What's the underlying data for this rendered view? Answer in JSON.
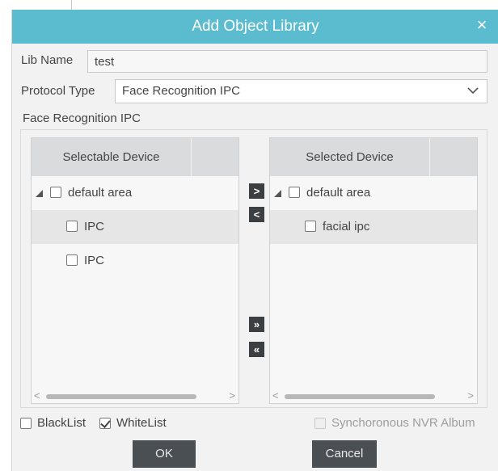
{
  "dialog": {
    "title": "Add Object Library",
    "close_glyph": "×",
    "colors": {
      "titlebar": "#5bbcd0",
      "button": "#4a4f54",
      "panel_header": "#d9dbdd"
    }
  },
  "form": {
    "lib_name": {
      "label": "Lib Name",
      "value": "test"
    },
    "protocol_type": {
      "label": "Protocol Type",
      "selected": "Face Recognition IPC"
    }
  },
  "group": {
    "title": "Face Recognition IPC",
    "selectable": {
      "header": "Selectable Device",
      "root": "default area",
      "devices": [
        "IPC",
        "IPC"
      ]
    },
    "selected": {
      "header": "Selected Device",
      "root": "default area",
      "devices": [
        "facial ipc"
      ]
    },
    "buttons": {
      "add": ">",
      "remove": "<",
      "add_all": "»",
      "remove_all": "«"
    },
    "scroll": {
      "left": "<",
      "right": ">"
    }
  },
  "options": {
    "blacklist": {
      "label": "BlackList",
      "checked": false
    },
    "whitelist": {
      "label": "WhiteList",
      "checked": true
    },
    "sync_nvr": {
      "label": "Synchoronous NVR Album",
      "checked": false,
      "enabled": false
    }
  },
  "footer": {
    "ok": "OK",
    "cancel": "Cancel"
  },
  "icons": {
    "close": "close-icon",
    "chevron": "chevron-down-icon",
    "expand": "expand-triangle-icon"
  }
}
